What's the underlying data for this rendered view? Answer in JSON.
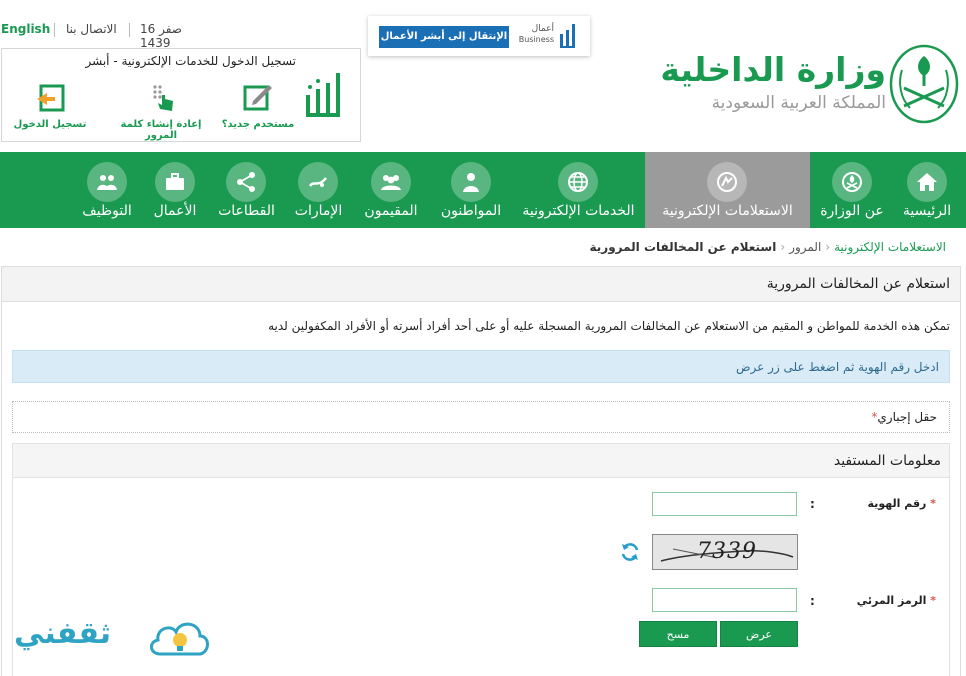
{
  "util": {
    "english": "English",
    "contact": "الاتصال بنا",
    "date": "16 صفر 1439"
  },
  "login": {
    "title": "تسجيل الدخول للخدمات الإلكترونية - أبشر",
    "new_user": "مستخدم جديد؟",
    "reset_password": "إعادة إنشاء كلمة المرور",
    "sign_in": "تسجيل الدخول"
  },
  "business": {
    "button": "الإنتقال إلى أبشر الأعمال",
    "logo_ar": "أعمال",
    "logo_en": "Business"
  },
  "ministry": {
    "title": "وزارة الداخلية",
    "subtitle": "المملكة العربية السعودية"
  },
  "nav": {
    "items": [
      {
        "label": "الرئيسية",
        "icon": "home-icon"
      },
      {
        "label": "عن الوزارة",
        "icon": "ministry-emblem-icon"
      },
      {
        "label": "الاستعلامات الإلكترونية",
        "icon": "inquiry-icon",
        "active": true
      },
      {
        "label": "الخدمات الإلكترونية",
        "icon": "globe-icon"
      },
      {
        "label": "المواطنون",
        "icon": "citizen-icon"
      },
      {
        "label": "المقيمون",
        "icon": "residents-icon"
      },
      {
        "label": "الإمارات",
        "icon": "emirates-icon"
      },
      {
        "label": "القطاعات",
        "icon": "share-icon"
      },
      {
        "label": "الأعمال",
        "icon": "briefcase-icon"
      },
      {
        "label": "التوظيف",
        "icon": "people-icon"
      }
    ]
  },
  "breadcrumb": {
    "item1": "الاستعلامات الإلكترونية",
    "item2": "المرور",
    "item3": "استعلام عن المخالفات المرورية"
  },
  "page": {
    "title": "استعلام عن المخالفات المرورية",
    "description": "تمكن هذه الخدمة للمواطن و المقيم من الاستعلام عن المخالفات المرورية المسجلة عليه أو على أحد أفراد أسرته أو الأفراد المكفولين لديه",
    "info": "ادخل رقم الهوية ثم اضغط على زر عرض",
    "required_star": "*",
    "required_note": "حقل إجباري"
  },
  "form": {
    "section_title": "معلومات المستفيد",
    "id_label": "رقم الهوية",
    "id_value": "",
    "captcha_text": "7339",
    "code_label": "الرمز المرئي",
    "code_value": "",
    "star": "*",
    "colon": ":",
    "view_button": "عرض",
    "clear_button": "مسح"
  },
  "watermark": {
    "text": "ثقفني"
  },
  "colors": {
    "brand_green": "#1a9a50",
    "active_tab": "#9b9b9b",
    "info_bg": "#d8ebf7",
    "business_blue": "#1b6fb5"
  }
}
